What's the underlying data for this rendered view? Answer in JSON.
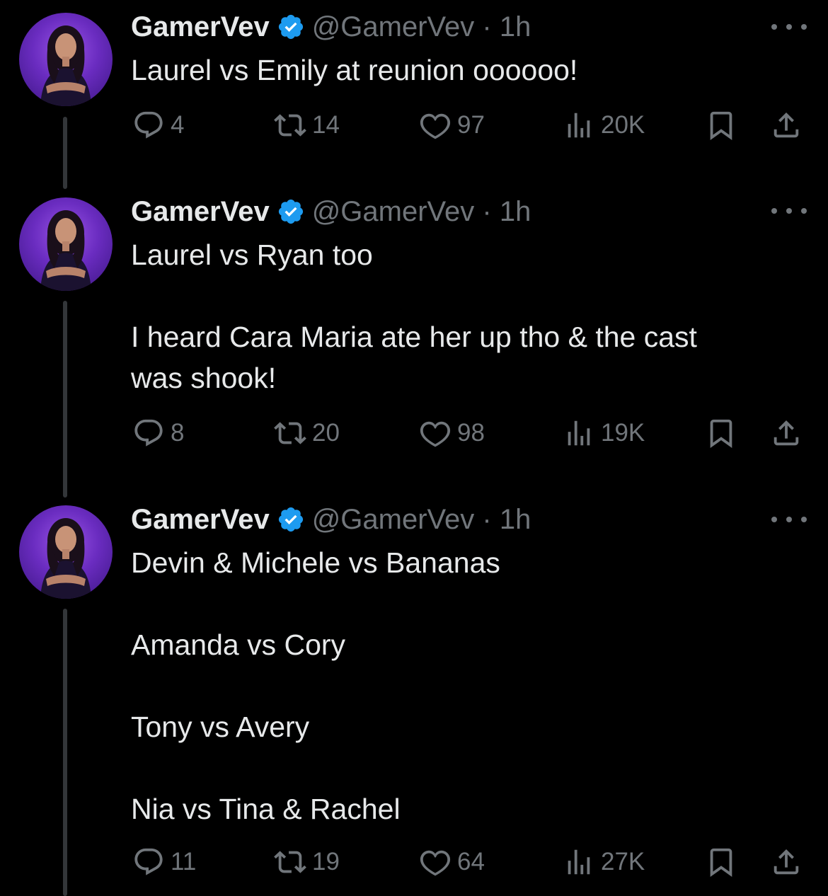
{
  "tweets": [
    {
      "name": "GamerVev",
      "handle_time": "@GamerVev · 1h",
      "text": "Laurel vs Emily at reunion oooooo!",
      "replies": "4",
      "retweets": "14",
      "likes": "97",
      "views": "20K"
    },
    {
      "name": "GamerVev",
      "handle_time": "@GamerVev · 1h",
      "text": "Laurel vs Ryan too\n\nI heard Cara Maria ate her up tho & the cast\nwas shook!",
      "replies": "8",
      "retweets": "20",
      "likes": "98",
      "views": "19K"
    },
    {
      "name": "GamerVev",
      "handle_time": "@GamerVev · 1h",
      "text": "Devin & Michele vs Bananas\n\nAmanda vs Cory\n\nTony vs Avery\n\nNia vs Tina & Rachel",
      "replies": "11",
      "retweets": "19",
      "likes": "64",
      "views": "27K"
    }
  ],
  "icons": {
    "verified": "verified-badge-icon",
    "reply": "reply-icon",
    "retweet": "retweet-icon",
    "like": "heart-icon",
    "views": "views-icon",
    "bookmark": "bookmark-icon",
    "share": "share-icon",
    "more": "more-icon"
  },
  "colors": {
    "background": "#000000",
    "text": "#e7e9ea",
    "muted": "#71767b",
    "verified": "#1d9bf0",
    "avatar": "#7b3fd6"
  }
}
